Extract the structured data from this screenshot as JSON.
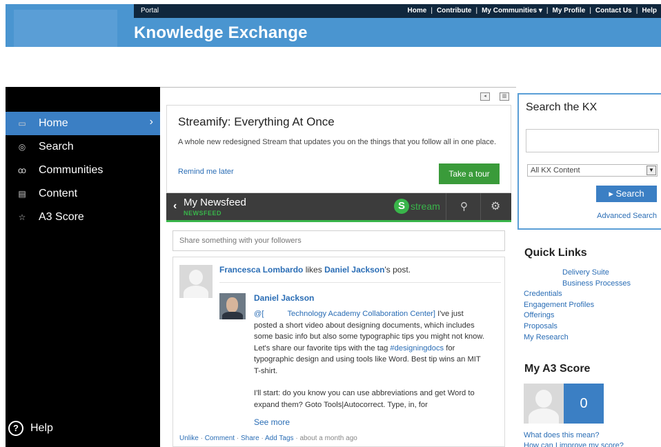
{
  "header": {
    "portal": "Portal",
    "brand": "Knowledge Exchange",
    "nav": [
      {
        "label": "Home"
      },
      {
        "label": "Contribute"
      },
      {
        "label": "My Communities ▾"
      },
      {
        "label": "My Profile"
      },
      {
        "label": "Contact Us"
      },
      {
        "label": "Help"
      }
    ]
  },
  "sidebar": {
    "items": [
      {
        "label": "Home",
        "icon": "home-icon",
        "active": true
      },
      {
        "label": "Search",
        "icon": "search-icon"
      },
      {
        "label": "Communities",
        "icon": "communities-icon"
      },
      {
        "label": "Content",
        "icon": "document-icon"
      },
      {
        "label": "A3 Score",
        "icon": "star-icon"
      }
    ],
    "help": "Help"
  },
  "promo": {
    "title": "Streamify: Everything At Once",
    "description": "A whole new redesigned Stream that updates you on the things that you follow all in one place.",
    "remind": "Remind me later",
    "button": "Take a tour"
  },
  "newsfeed": {
    "title": "My Newsfeed",
    "subtitle": "NEWSFEED",
    "logo": "stream"
  },
  "share": {
    "placeholder": "Share something with your followers"
  },
  "post": {
    "actor": "Francesca Lombardo",
    "verb": "likes",
    "target": "Daniel Jackson",
    "suffix": "'s post.",
    "author": "Daniel Jackson",
    "mention_prefix": "@[",
    "mention_link": "Technology Academy Collaboration Center]",
    "body1_rest": " I've just posted a short video about designing documents, which includes some basic info but also some typographic tips you might not know. Let's share our favorite tips with the tag ",
    "hashtag": "#designingdocs",
    "body1_end": " for typographic design and using tools like Word. Best tip wins an MIT T-shirt.",
    "body2": "I'll start: do you know you can use abbreviations and get Word to expand them? Goto Tools|Autocorrect. Type, in, for",
    "see_more": "See more",
    "actions": [
      "Unlike",
      "Comment",
      "Share",
      "Add Tags"
    ],
    "time": "about a month ago"
  },
  "search_panel": {
    "title": "Search the KX",
    "scope": "All KX Content",
    "button": "Search",
    "advanced": "Advanced Search"
  },
  "quick_links": {
    "title": "Quick Links",
    "items": [
      {
        "label": "Delivery Suite",
        "indent": true
      },
      {
        "label": "Business Processes",
        "indent": true
      },
      {
        "label": "Credentials"
      },
      {
        "label": "Engagement Profiles"
      },
      {
        "label": "Offerings"
      },
      {
        "label": "Proposals"
      },
      {
        "label": "My Research"
      }
    ]
  },
  "a3": {
    "title": "My A3 Score",
    "score": "0",
    "links": [
      "What does this mean?",
      "How can I improve my score?"
    ]
  },
  "colors": {
    "brand_blue": "#4a95d0",
    "accent_blue": "#3b7fc4",
    "header_dark": "#10273d",
    "green": "#39b54a",
    "link": "#2a6db5"
  }
}
